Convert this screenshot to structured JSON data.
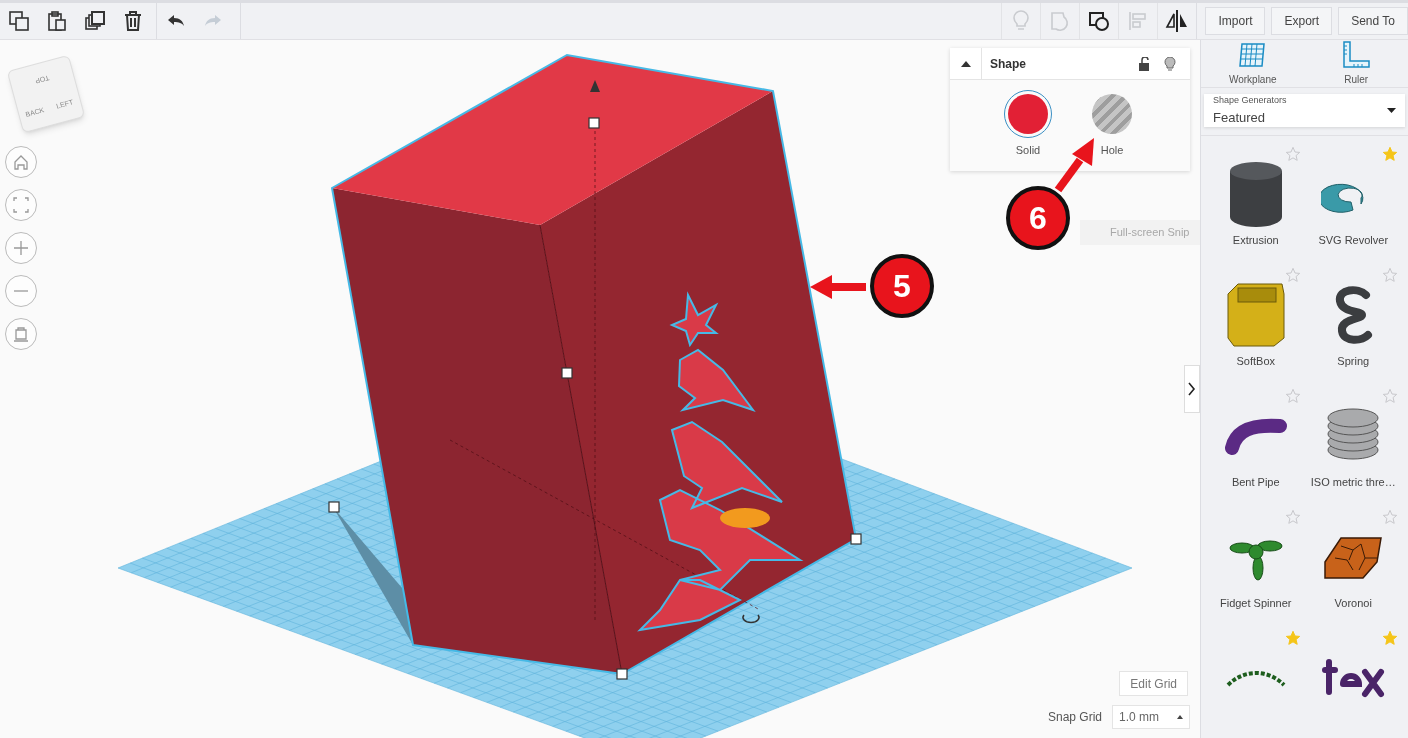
{
  "toolbar": {
    "edit_tools": [
      {
        "kind": "copy",
        "disabled": false
      },
      {
        "kind": "paste",
        "disabled": false
      },
      {
        "kind": "duplicate",
        "disabled": false
      },
      {
        "kind": "delete",
        "disabled": false
      },
      {
        "kind": "undo",
        "disabled": false
      },
      {
        "kind": "redo",
        "disabled": true
      }
    ],
    "view_tools": [
      {
        "kind": "notes",
        "disabled": true
      },
      {
        "kind": "group",
        "disabled": true
      },
      {
        "kind": "ungroup",
        "disabled": false
      },
      {
        "kind": "align",
        "disabled": true
      },
      {
        "kind": "mirror",
        "disabled": false
      }
    ],
    "buttons": [
      "Import",
      "Export",
      "Send To"
    ]
  },
  "view_cube": {
    "faces": [
      "TOP",
      "BACK",
      "LEFT"
    ]
  },
  "shape_panel": {
    "title": "Shape",
    "options": [
      {
        "kind": "solid",
        "label": "Solid",
        "selected": true
      },
      {
        "kind": "hole",
        "label": "Hole",
        "selected": false
      }
    ]
  },
  "callouts": [
    {
      "label": "5"
    },
    {
      "label": "6"
    }
  ],
  "overlay_text": "Full-screen Snip",
  "grid_controls": {
    "edit_button": "Edit Grid",
    "snap_label": "Snap Grid",
    "snap_value": "1.0 mm"
  },
  "sidebar": {
    "tools": [
      {
        "kind": "workplane",
        "label": "Workplane"
      },
      {
        "kind": "ruler",
        "label": "Ruler"
      }
    ],
    "generator": {
      "caption": "Shape Generators",
      "value": "Featured"
    },
    "shapes": [
      {
        "kind": "extrusion",
        "name": "Extrusion",
        "favorite": false
      },
      {
        "kind": "revolver",
        "name": "SVG Revolver",
        "favorite": true
      },
      {
        "kind": "softbox",
        "name": "SoftBox",
        "favorite": false
      },
      {
        "kind": "spring",
        "name": "Spring",
        "favorite": false
      },
      {
        "kind": "pipe",
        "name": "Bent Pipe",
        "favorite": false
      },
      {
        "kind": "thread",
        "name": "ISO metric thre…",
        "favorite": false
      },
      {
        "kind": "spinner",
        "name": "Fidget Spinner",
        "favorite": false
      },
      {
        "kind": "voronoi",
        "name": "Voronoi",
        "favorite": false
      },
      {
        "kind": "arc_text",
        "favorite": true
      },
      {
        "kind": "text",
        "favorite": true
      }
    ]
  }
}
